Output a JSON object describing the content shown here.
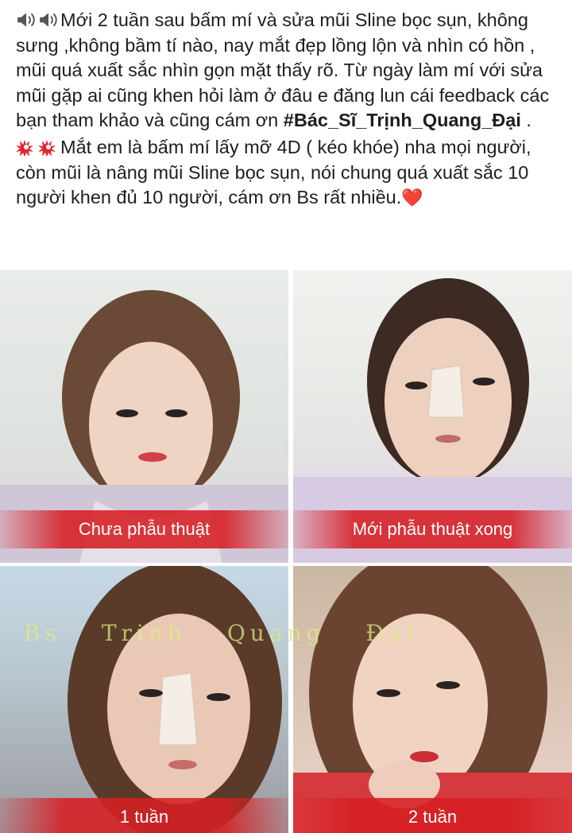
{
  "post": {
    "paragraph1": "Mới 2 tuần sau bấm mí và sửa mũi Sline bọc sụn, không sưng ,không bầm tí nào, nay mắt đẹp lồng lộn và nhìn có hồn , mũi quá xuất sắc nhìn gọn mặt thấy rõ. Từ ngày làm mí với sửa mũi gặp ai cũng khen hỏi làm ở đâu e đăng lun cái feedback các bạn tham khảo và cũng cám ơn",
    "hashtag": "#Bác_Sĩ_Trịnh_Quang_Đại",
    "hashtag_suffix": " .",
    "paragraph2": "Mắt em là bấm mí lấy mỡ 4D ( kéo khóe) nha mọi người, còn mũi là nâng mũi Sline bọc sụn, nói chung quá xuất sắc 10 người khen đủ 10 người, cám ơn Bs rất nhiều.",
    "heart_emoji": "❤️",
    "emoji1": "speaker-icon",
    "emoji2": "anger-icon",
    "accent_color": "#d61e23"
  },
  "photos": [
    {
      "caption": "Chưa phẫu thuật",
      "description": "before-surgery-photo"
    },
    {
      "caption": "Mới phẫu thuật xong",
      "description": "just-after-surgery-photo"
    },
    {
      "caption": "1 tuần",
      "description": "one-week-photo"
    },
    {
      "caption": "2 tuần",
      "description": "two-weeks-photo"
    }
  ],
  "watermark": "Bs Trinh Quang Đại"
}
